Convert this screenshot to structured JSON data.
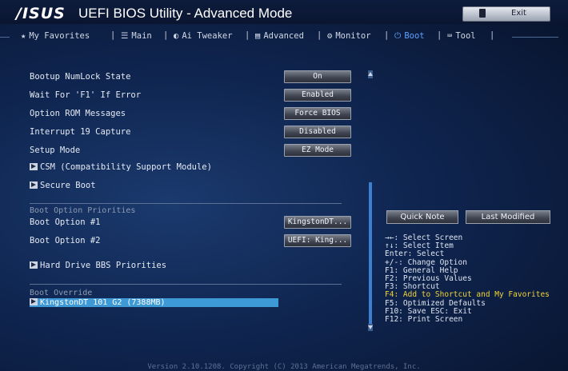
{
  "window": {
    "brand": "/ISUS",
    "title": "UEFI BIOS Utility - Advanced Mode",
    "exit_label": "Exit"
  },
  "tabs": [
    {
      "label": "My Favorites",
      "icon": "star-icon"
    },
    {
      "label": "Main",
      "icon": "list-icon"
    },
    {
      "label": "Ai Tweaker",
      "icon": "tweaker-icon"
    },
    {
      "label": "Advanced",
      "icon": "advanced-icon"
    },
    {
      "label": "Monitor",
      "icon": "monitor-icon"
    },
    {
      "label": "Boot",
      "icon": "power-icon",
      "active": true
    },
    {
      "label": "Tool",
      "icon": "tool-icon"
    }
  ],
  "settings": [
    {
      "label": "Bootup NumLock State",
      "value": "On"
    },
    {
      "label": "Wait For 'F1' If Error",
      "value": "Enabled"
    },
    {
      "label": "Option ROM Messages",
      "value": "Force BIOS"
    },
    {
      "label": "Interrupt 19 Capture",
      "value": "Disabled"
    },
    {
      "label": "Setup Mode",
      "value": "EZ Mode"
    }
  ],
  "submenus": {
    "csm": "CSM (Compatibility Support Module)",
    "secure_boot": "Secure Boot",
    "hdd_bbs": "Hard Drive BBS Priorities"
  },
  "boot_priorities": {
    "section_title": "Boot Option Priorities",
    "options": [
      {
        "label": "Boot Option #1",
        "value": "KingstonDT..."
      },
      {
        "label": "Boot Option #2",
        "value": "UEFI: King..."
      }
    ]
  },
  "boot_override": {
    "section_title": "Boot Override",
    "item": "KingstonDT 101 G2  (7388MB)"
  },
  "right_panel": {
    "quick_note": "Quick Note",
    "last_modified": "Last Modified",
    "help": [
      {
        "text": "→←: Select Screen",
        "highlight": false
      },
      {
        "text": "↑↓: Select Item",
        "highlight": false
      },
      {
        "text": "Enter: Select",
        "highlight": false
      },
      {
        "text": "+/-: Change Option",
        "highlight": false
      },
      {
        "text": "F1: General Help",
        "highlight": false
      },
      {
        "text": "F2: Previous Values",
        "highlight": false
      },
      {
        "text": "F3: Shortcut",
        "highlight": false
      },
      {
        "text": "F4: Add to Shortcut and My Favorites",
        "highlight": true
      },
      {
        "text": "F5: Optimized Defaults",
        "highlight": false
      },
      {
        "text": "F10: Save  ESC: Exit",
        "highlight": false
      },
      {
        "text": "F12: Print Screen",
        "highlight": false
      }
    ]
  },
  "footer": "Version 2.10.1208. Copyright (C) 2013 American Megatrends, Inc."
}
